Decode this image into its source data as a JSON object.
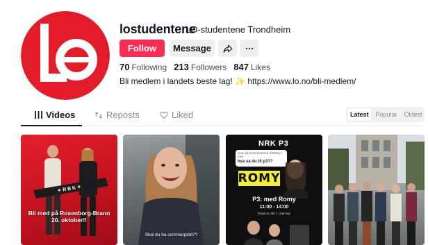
{
  "profile": {
    "username": "lostudentene",
    "nickname": "LO-studentene Trondheim",
    "follow_label": "Follow",
    "message_label": "Message",
    "share_icon": "share-icon",
    "more_icon": "more-icon",
    "bio": "Bli medlem i landets beste lag! ✨ https://www.lo.no/bli-medlem/"
  },
  "stats": {
    "following_count": "70",
    "following_label": "Following",
    "followers_count": "213",
    "followers_label": "Followers",
    "likes_count": "847",
    "likes_label": "Likes"
  },
  "tabs": {
    "videos": "Videos",
    "reposts": "Reposts",
    "liked": "Liked"
  },
  "sort": {
    "latest": "Latest",
    "popular": "Popular",
    "oldest": "Oldest"
  },
  "videos": [
    {
      "caption": "Bli med på Rosenborg-Brann 20. oktober!!"
    },
    {
      "caption": "Skal du ha sommerjobb??"
    },
    {
      "logo": "NRK P3",
      "card_small": "Svar på kommentaren til Romy i Live",
      "card_question": "hva sa du til p3??",
      "brand": "ROMY",
      "title": "P3: med Romy",
      "time": "11:00 - 14:00",
      "sub": "Dropt av det 1. mai tog!"
    },
    {
      "caption": ""
    }
  ],
  "colors": {
    "accent": "#fe2c55",
    "brand_red": "#e41c2a"
  }
}
